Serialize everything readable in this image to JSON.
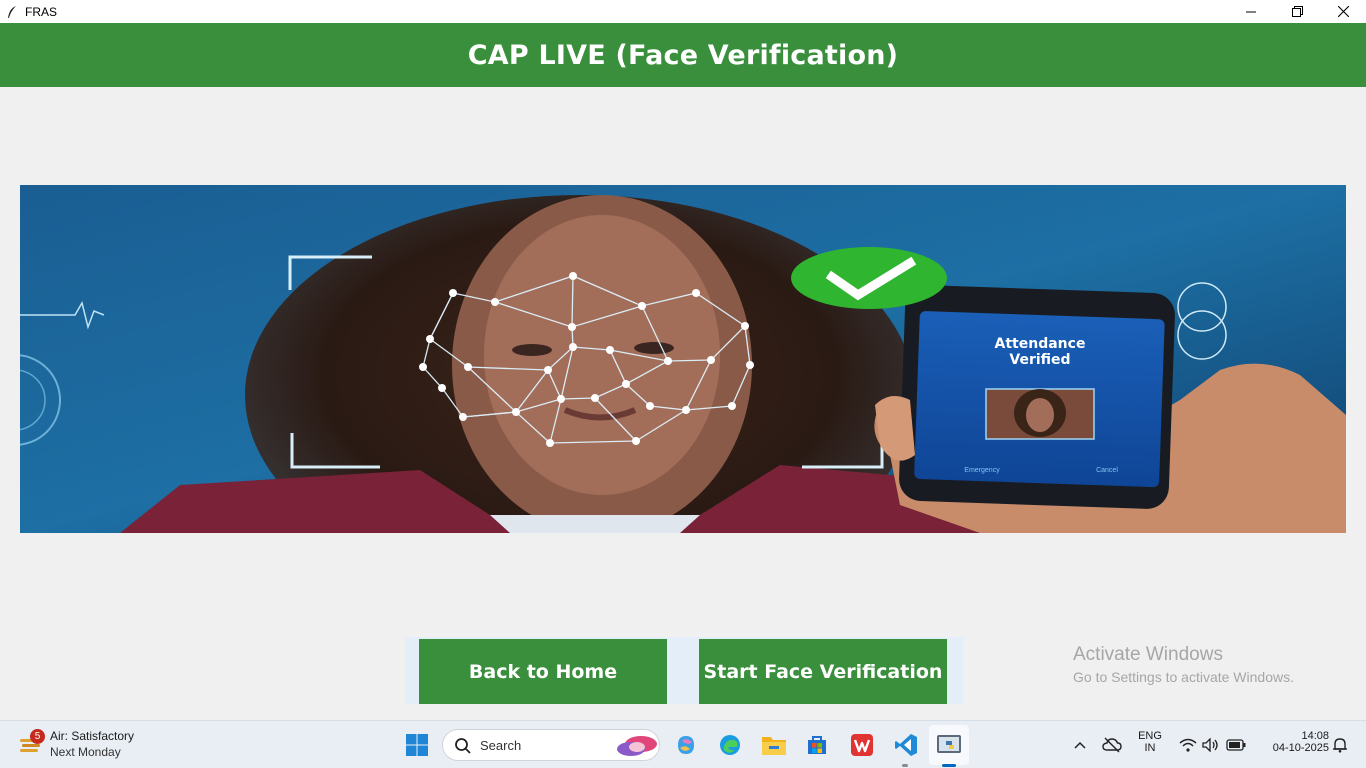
{
  "window": {
    "title": "FRAS"
  },
  "header": {
    "title": "CAP LIVE (Face Verification)"
  },
  "banner": {
    "phone_title_line1": "Attendance",
    "phone_title_line2": "Verified",
    "phone_left": "Emergency",
    "phone_right": "Cancel"
  },
  "buttons": {
    "back": "Back to Home",
    "start": "Start Face Verification"
  },
  "watermark": {
    "line1": "Activate Windows",
    "line2": "Go to Settings to activate Windows."
  },
  "taskbar": {
    "weather": {
      "badge": "5",
      "line1": "Air: Satisfactory",
      "line2": "Next Monday"
    },
    "search_placeholder": "Search",
    "language": {
      "line1": "ENG",
      "line2": "IN"
    },
    "clock": {
      "time": "14:08",
      "date": "04-10-2025"
    }
  },
  "colors": {
    "header": "#3a8f3c",
    "button": "#3a8f3c",
    "taskbar": "#e9eef5",
    "accent": "#0067c0"
  }
}
